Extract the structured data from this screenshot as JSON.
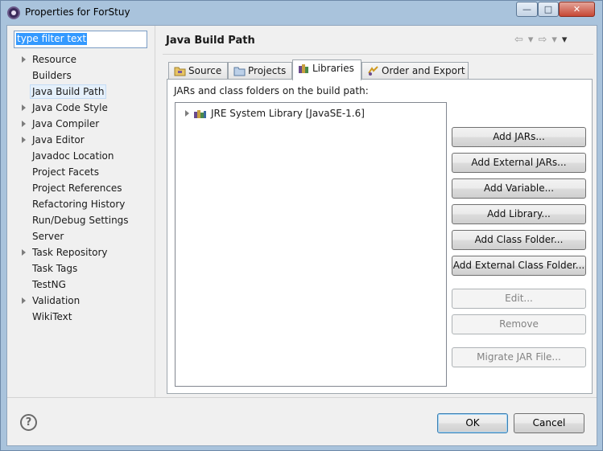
{
  "window": {
    "title": "Properties for ForStuy",
    "min_glyph": "—",
    "max_glyph": "□",
    "close_glyph": "✕"
  },
  "filter": {
    "value": "type filter text"
  },
  "nav": {
    "items": [
      {
        "label": "Resource",
        "expandable": true
      },
      {
        "label": "Builders",
        "expandable": false
      },
      {
        "label": "Java Build Path",
        "expandable": false,
        "selected": true
      },
      {
        "label": "Java Code Style",
        "expandable": true
      },
      {
        "label": "Java Compiler",
        "expandable": true
      },
      {
        "label": "Java Editor",
        "expandable": true
      },
      {
        "label": "Javadoc Location",
        "expandable": false
      },
      {
        "label": "Project Facets",
        "expandable": false
      },
      {
        "label": "Project References",
        "expandable": false
      },
      {
        "label": "Refactoring History",
        "expandable": false
      },
      {
        "label": "Run/Debug Settings",
        "expandable": false
      },
      {
        "label": "Server",
        "expandable": false
      },
      {
        "label": "Task Repository",
        "expandable": true
      },
      {
        "label": "Task Tags",
        "expandable": false
      },
      {
        "label": "TestNG",
        "expandable": false
      },
      {
        "label": "Validation",
        "expandable": true
      },
      {
        "label": "WikiText",
        "expandable": false
      }
    ]
  },
  "page": {
    "title": "Java Build Path",
    "back_glyph": "⇦",
    "forward_glyph": "⇨",
    "menu_glyph": "▾"
  },
  "tabs": [
    {
      "label": "Source"
    },
    {
      "label": "Projects"
    },
    {
      "label": "Libraries",
      "active": true
    },
    {
      "label": "Order and Export"
    }
  ],
  "libraries": {
    "heading": "JARs and class folders on the build path:",
    "entries": [
      {
        "label": "JRE System Library [JavaSE-1.6]"
      }
    ]
  },
  "buttons": {
    "add_jars": "Add JARs...",
    "add_external_jars": "Add External JARs...",
    "add_variable": "Add Variable...",
    "add_library": "Add Library...",
    "add_class_folder": "Add Class Folder...",
    "add_external_class_folder": "Add External Class Folder...",
    "edit": "Edit...",
    "remove": "Remove",
    "migrate_jar": "Migrate JAR File..."
  },
  "dialog": {
    "help_glyph": "?",
    "ok": "OK",
    "cancel": "Cancel"
  }
}
